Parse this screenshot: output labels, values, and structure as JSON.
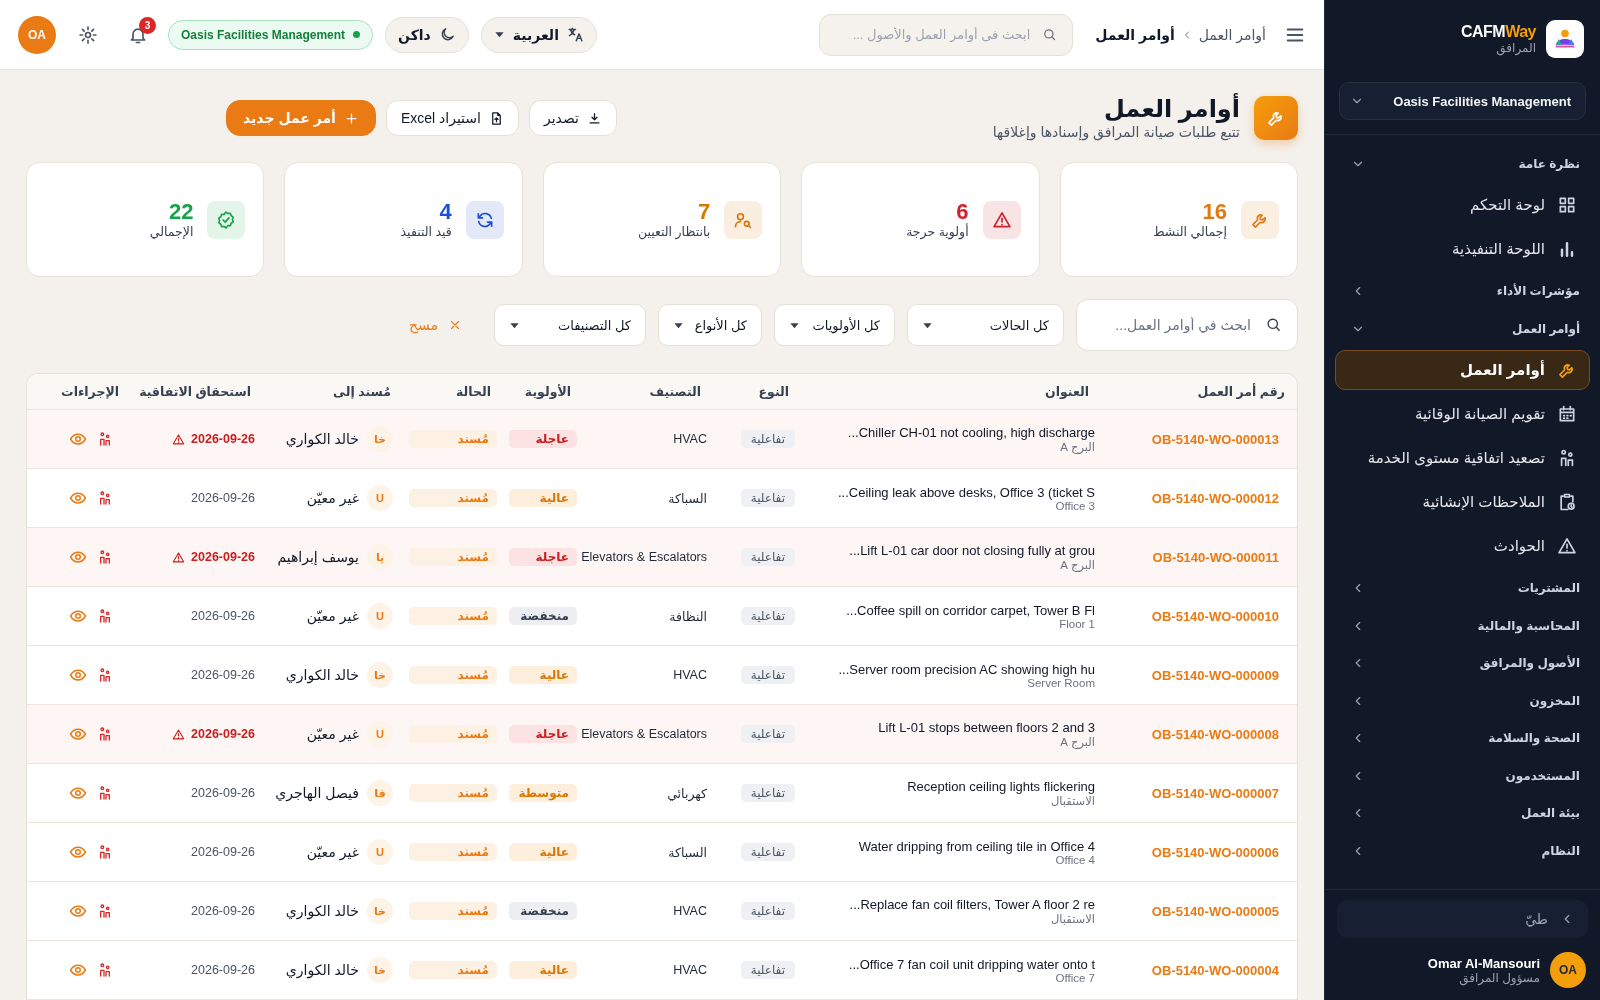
{
  "sidebar": {
    "brand": {
      "name_a": "CAFM",
      "name_b": "Way",
      "subtitle": "المرافق"
    },
    "org_select": "Oasis Facilities Management",
    "groups": [
      {
        "label": "نظرة عامة",
        "expanded": true,
        "children": [
          {
            "label": "لوحة التحكم",
            "selected": false
          },
          {
            "label": "اللوحة التنفيذية",
            "selected": false
          }
        ]
      },
      {
        "label": "مؤشرات الأداء",
        "expanded": false
      },
      {
        "label": "أوامر العمل",
        "expanded": true,
        "children": [
          {
            "label": "أوامر العمل",
            "selected": true
          },
          {
            "label": "تقويم الصيانة الوقائية",
            "selected": false
          },
          {
            "label": "تصعيد اتفاقية مستوى الخدمة",
            "selected": false
          },
          {
            "label": "الملاحظات الإنشائية",
            "selected": false
          },
          {
            "label": "الحوادث",
            "selected": false
          }
        ]
      },
      {
        "label": "المشتريات",
        "expanded": false
      },
      {
        "label": "المحاسبة والمالية",
        "expanded": false
      },
      {
        "label": "الأصول والمرافق",
        "expanded": false
      },
      {
        "label": "المخزون",
        "expanded": false
      },
      {
        "label": "الصحة والسلامة",
        "expanded": false
      },
      {
        "label": "المستخدمون",
        "expanded": false
      },
      {
        "label": "بيئة العمل",
        "expanded": false
      },
      {
        "label": "النظام",
        "expanded": false
      }
    ],
    "collapse_button": "طيّ",
    "user": {
      "name": "Omar Al-Mansouri",
      "role": "مسؤول المرافق",
      "initials": "OA"
    }
  },
  "header": {
    "breadcrumb": [
      "أوامر العمل",
      "أوامر العمل"
    ],
    "search": {
      "placeholder": "ابحث فى أوامر العمل والأصول ..."
    },
    "language": "العربية",
    "theme": "داكن",
    "org_badge": "Oasis Facilities Management",
    "notifications": "3",
    "avatar": "OA"
  },
  "page": {
    "title": "أوامر العمل",
    "subtitle": "تتبع طلبات صيانة المرافق وإسنادها وإغلاقها",
    "actions": [
      {
        "label": "تصدير",
        "kind": "export"
      },
      {
        "label": "استيراد Excel",
        "kind": "import"
      },
      {
        "label": "أمر عمل جديد",
        "kind": "primary"
      }
    ]
  },
  "stats": [
    {
      "value": "16",
      "label": "إجمالي النشط",
      "color": "#e07b14"
    },
    {
      "value": "6",
      "label": "أولوية حرجة",
      "color": "#d0202a"
    },
    {
      "value": "7",
      "label": "بانتظار التعيين",
      "color": "#d97706"
    },
    {
      "value": "4",
      "label": "قيد التنفيذ",
      "color": "#1d4ed8"
    },
    {
      "value": "22",
      "label": "الإجمالي",
      "color": "#16a34a"
    }
  ],
  "filters": {
    "search": {
      "placeholder": "ابحث في أوامر العمل..."
    },
    "selects": [
      "كل الحالات",
      "كل الأولويات",
      "كل الأنواع",
      "كل التصنيفات"
    ],
    "clear": "مسح"
  },
  "table": {
    "columns": [
      "رقم أمر العمل",
      "العنوان",
      "النوع",
      "التصنيف",
      "الأولوية",
      "الحالة",
      "مُسند إلى",
      "استحقاق الاتفاقية",
      "الإجراءات"
    ],
    "rows": [
      {
        "id": "OB-5140-WO-000013",
        "title": "Chiller CH-01 not cooling, high discharge...",
        "location": "البرج A",
        "type": "تفاعلية",
        "category": "HVAC",
        "priority": {
          "label": "عاجلة",
          "kind": "urgent"
        },
        "status": "مُسند",
        "assignee_initials": "خا",
        "assignee": "خالد الكواري",
        "due": "2026-09-26",
        "overdue": true
      },
      {
        "id": "OB-5140-WO-000012",
        "title": "Ceiling leak above desks, Office 3 (ticket S...",
        "location": "Office 3",
        "type": "تفاعلية",
        "category": "السباكة",
        "priority": {
          "label": "عالية",
          "kind": "high"
        },
        "status": "مُسند",
        "assignee_initials": "U",
        "assignee": "غير معيّن",
        "due": "2026-09-26",
        "overdue": false
      },
      {
        "id": "OB-5140-WO-000011",
        "title": "Lift L-01 car door not closing fully at grou...",
        "location": "البرج A",
        "type": "تفاعلية",
        "category": "Elevators & Escalators",
        "priority": {
          "label": "عاجلة",
          "kind": "urgent"
        },
        "status": "مُسند",
        "assignee_initials": "يا",
        "assignee": "يوسف إبراهيم",
        "due": "2026-09-26",
        "overdue": true
      },
      {
        "id": "OB-5140-WO-000010",
        "title": "Coffee spill on corridor carpet, Tower B Fl...",
        "location": "Floor 1",
        "type": "تفاعلية",
        "category": "النظافة",
        "priority": {
          "label": "منخفضة",
          "kind": "low"
        },
        "status": "مُسند",
        "assignee_initials": "U",
        "assignee": "غير معيّن",
        "due": "2026-09-26",
        "overdue": false
      },
      {
        "id": "OB-5140-WO-000009",
        "title": "Server room precision AC showing high hu...",
        "location": "Server Room",
        "type": "تفاعلية",
        "category": "HVAC",
        "priority": {
          "label": "عالية",
          "kind": "high"
        },
        "status": "مُسند",
        "assignee_initials": "خا",
        "assignee": "خالد الكواري",
        "due": "2026-09-26",
        "overdue": false
      },
      {
        "id": "OB-5140-WO-000008",
        "title": "Lift L-01 stops between floors 2 and 3",
        "location": "البرج A",
        "type": "تفاعلية",
        "category": "Elevators & Escalators",
        "priority": {
          "label": "عاجلة",
          "kind": "urgent"
        },
        "status": "مُسند",
        "assignee_initials": "U",
        "assignee": "غير معيّن",
        "due": "2026-09-26",
        "overdue": true
      },
      {
        "id": "OB-5140-WO-000007",
        "title": "Reception ceiling lights flickering",
        "location": "الاستقبال",
        "type": "تفاعلية",
        "category": "كهربائي",
        "priority": {
          "label": "متوسطة",
          "kind": "medium"
        },
        "status": "مُسند",
        "assignee_initials": "فا",
        "assignee": "فيصل الهاجري",
        "due": "2026-09-26",
        "overdue": false
      },
      {
        "id": "OB-5140-WO-000006",
        "title": "Water dripping from ceiling tile in Office 4",
        "location": "Office 4",
        "type": "تفاعلية",
        "category": "السباكة",
        "priority": {
          "label": "عالية",
          "kind": "high"
        },
        "status": "مُسند",
        "assignee_initials": "U",
        "assignee": "غير معيّن",
        "due": "2026-09-26",
        "overdue": false
      },
      {
        "id": "OB-5140-WO-000005",
        "title": "Replace fan coil filters, Tower A floor 2 re...",
        "location": "الاستقبال",
        "type": "تفاعلية",
        "category": "HVAC",
        "priority": {
          "label": "منخفضة",
          "kind": "low"
        },
        "status": "مُسند",
        "assignee_initials": "خا",
        "assignee": "خالد الكواري",
        "due": "2026-09-26",
        "overdue": false
      },
      {
        "id": "OB-5140-WO-000004",
        "title": "Office 7 fan coil unit dripping water onto t...",
        "location": "Office 7",
        "type": "تفاعلية",
        "category": "HVAC",
        "priority": {
          "label": "عالية",
          "kind": "high"
        },
        "status": "مُسند",
        "assignee_initials": "خا",
        "assignee": "خالد الكواري",
        "due": "2026-09-26",
        "overdue": false
      }
    ]
  }
}
